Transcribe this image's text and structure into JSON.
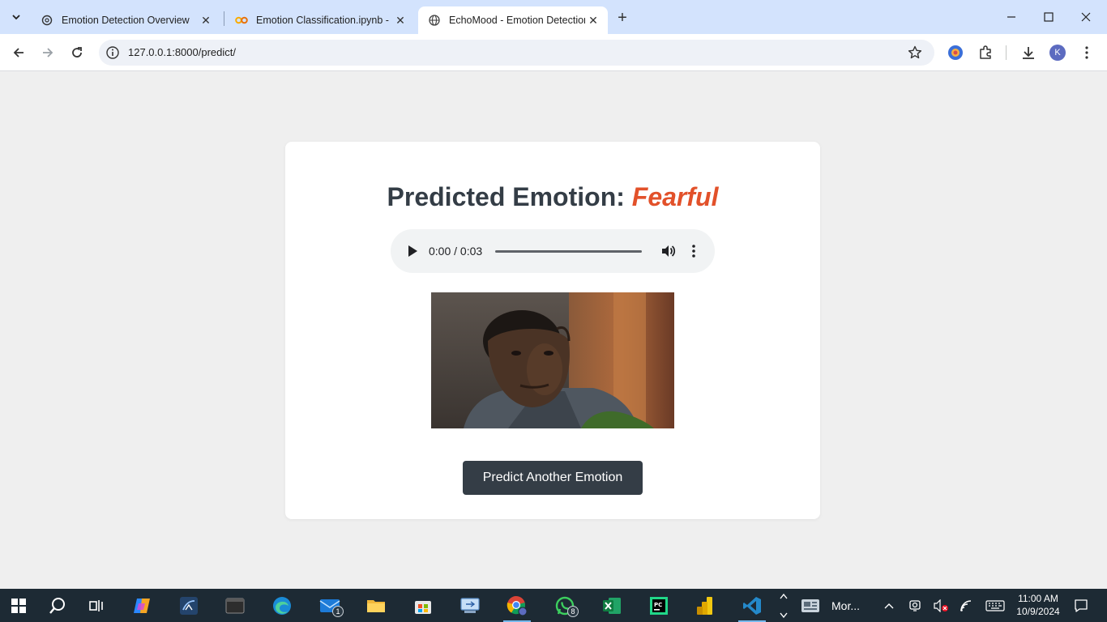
{
  "browser": {
    "tabs": [
      {
        "title": "Emotion Detection Overview",
        "active": false,
        "favicon": "openai-icon"
      },
      {
        "title": "Emotion Classification.ipynb - C",
        "active": false,
        "favicon": "colab-icon"
      },
      {
        "title": "EchoMood - Emotion Detection",
        "active": true,
        "favicon": "globe-icon"
      }
    ],
    "url": "127.0.0.1:8000/predict/",
    "profile_initial": "K"
  },
  "page": {
    "heading_prefix": "Predicted Emotion: ",
    "emotion": "Fearful",
    "audio": {
      "time": "0:00 / 0:03",
      "progress": 0
    },
    "button_label": "Predict Another Emotion",
    "colors": {
      "accent": "#e2512a",
      "button": "#343d46",
      "card": "#ffffff",
      "background": "#efefef"
    }
  },
  "taskbar": {
    "apps": [
      {
        "name": "start"
      },
      {
        "name": "search"
      },
      {
        "name": "task-view"
      },
      {
        "name": "copilot"
      },
      {
        "name": "mysql-workbench"
      },
      {
        "name": "terminal"
      },
      {
        "name": "edge"
      },
      {
        "name": "mail",
        "badge": "1"
      },
      {
        "name": "file-explorer"
      },
      {
        "name": "store"
      },
      {
        "name": "remote-desktop"
      },
      {
        "name": "chrome"
      },
      {
        "name": "whatsapp",
        "badge": "8"
      },
      {
        "name": "excel"
      },
      {
        "name": "pycharm"
      },
      {
        "name": "power-bi"
      },
      {
        "name": "vscode"
      }
    ],
    "news_label": "Mor...",
    "clock": {
      "time": "11:00 AM",
      "date": "10/9/2024"
    }
  }
}
